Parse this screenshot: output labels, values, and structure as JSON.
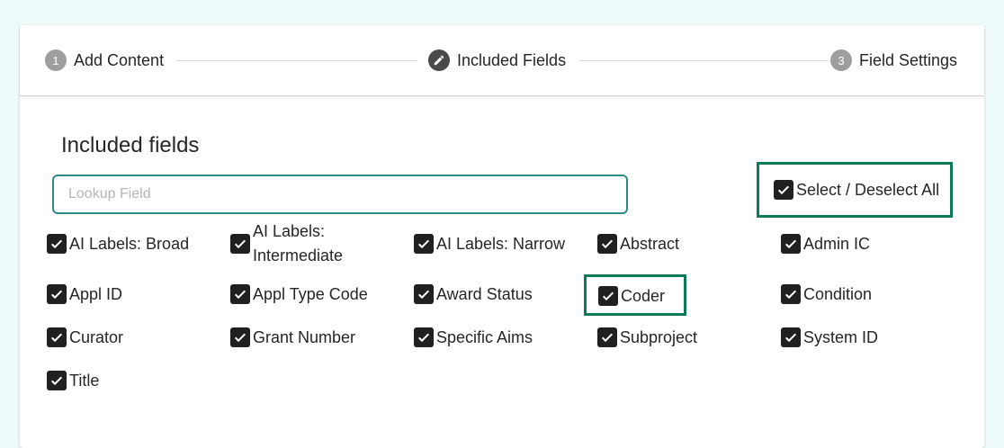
{
  "stepper": {
    "steps": [
      {
        "number": "1",
        "label": "Add Content"
      },
      {
        "number": "",
        "label": "Included Fields",
        "icon": "pencil-icon"
      },
      {
        "number": "3",
        "label": "Field Settings"
      }
    ]
  },
  "section": {
    "title": "Included fields"
  },
  "lookup": {
    "placeholder": "Lookup Field",
    "value": ""
  },
  "select_all": {
    "label": "Select / Deselect All",
    "checked": true
  },
  "fields": [
    {
      "label": "AI Labels: Broad",
      "checked": true
    },
    {
      "label": "AI Labels: Intermediate",
      "checked": true
    },
    {
      "label": "AI Labels: Narrow",
      "checked": true
    },
    {
      "label": "Abstract",
      "checked": true
    },
    {
      "label": "Admin IC",
      "checked": true
    },
    {
      "label": "Appl ID",
      "checked": true
    },
    {
      "label": "Appl Type Code",
      "checked": true
    },
    {
      "label": "Award Status",
      "checked": true
    },
    {
      "label": "Coder",
      "checked": true
    },
    {
      "label": "Condition",
      "checked": true
    },
    {
      "label": "Curator",
      "checked": true
    },
    {
      "label": "Grant Number",
      "checked": true
    },
    {
      "label": "Specific Aims",
      "checked": true
    },
    {
      "label": "Subproject",
      "checked": true
    },
    {
      "label": "System ID",
      "checked": true
    },
    {
      "label": "Title",
      "checked": true
    }
  ],
  "colors": {
    "background": "#eefafa",
    "highlight_border": "#0c7a55",
    "input_border": "#2f8a85",
    "checkbox": "#202020"
  }
}
